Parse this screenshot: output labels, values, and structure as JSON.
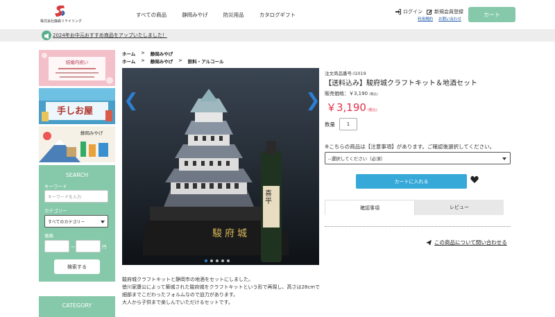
{
  "header": {
    "company": "株式会社静鉄リテイリング",
    "nav": [
      "すべての商品",
      "静岡みやげ",
      "防災用品",
      "カタログギフト"
    ],
    "login": "ログイン",
    "register": "新規会員登録",
    "terms": "利用規約",
    "contact": "お問い合わせ",
    "cart": "カート"
  },
  "notice": {
    "text": "2024年お中元おすすめ商品をアップいたしました！"
  },
  "sidebar": {
    "banner1_title": "結婚内祝い",
    "banner2_title": "手しお屋",
    "banner3_title": "静岡みやげ",
    "search_title": "SEARCH",
    "keyword_label": "キーワード",
    "keyword_placeholder": "キーワードを入力",
    "category_label": "カテゴリー",
    "category_selected": "すべてのカテゴリー",
    "price_label": "価格",
    "price_tilde": "～",
    "price_unit": "円",
    "search_button": "検索する",
    "category_heading": "CATEGORY"
  },
  "breadcrumbs": [
    [
      "ホーム",
      "静岡みやげ"
    ],
    [
      "ホーム",
      "静岡みやげ",
      "飲料・アルコール"
    ]
  ],
  "product": {
    "code": "注文商品番号:I1019",
    "title": "【送料込み】駿府城クラフトキット＆地酒セット",
    "price_label": "販売価格：￥3,190",
    "price_label_tax": "(税込)",
    "price": "￥3,190",
    "price_tax": "(税込)",
    "qty_label": "数量",
    "qty_value": "1",
    "attention": "※こちらの商品は【注意事項】があります。ご確認後選択してください。",
    "option_selected": "--選択してください（必須）",
    "add_to_cart": "カートに入れる",
    "tab_notes": "確認事項",
    "tab_review": "レビュー",
    "inquiry": "この商品について問い合わせる",
    "gallery_sign": "駿府城",
    "gallery_bottle": "喜平"
  },
  "description": [
    "駿府城クラフトキットと静岡市の地酒をセットにしました。",
    "徳川家康公によって築城された駿府城をクラフトキットという形で再現し、高さは28cmで",
    "細部までこだわったフォルムなので迫力があります。",
    "大人から子供まで楽しんでいただけるセットです。"
  ],
  "colors": {
    "accent_green": "#86c8aa",
    "price_red": "#e2304a",
    "cart_blue": "#36a9d8"
  }
}
